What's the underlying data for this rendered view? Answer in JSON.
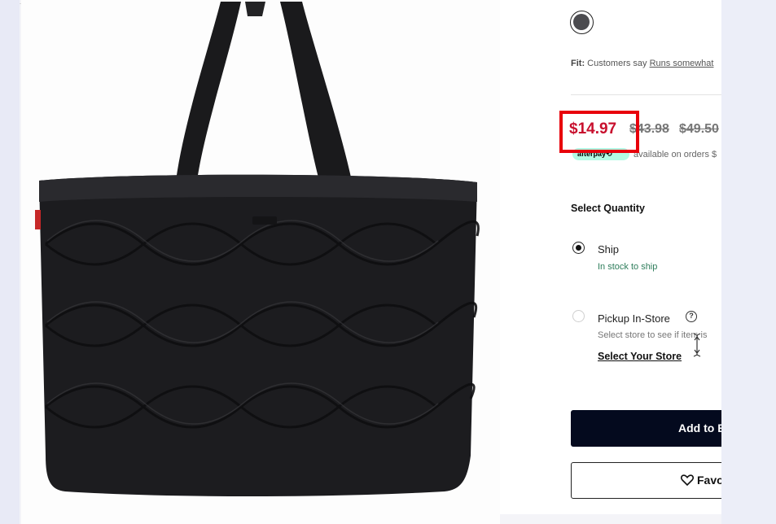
{
  "product": {
    "image_alt": "Black quilted puffer tote bag",
    "color_swatch": "#4b4b4f"
  },
  "fit": {
    "label": "Fit:",
    "text": "Customers say",
    "link": "Runs somewhat"
  },
  "price": {
    "sale": "$14.97",
    "original_1": "$43.98",
    "original_2": "$49.50",
    "sale_color": "#c8102e",
    "highlight_color": "#e8000b"
  },
  "afterpay": {
    "badge": "afterpay⟲",
    "text": "available on orders $"
  },
  "quantity": {
    "heading": "Select Quantity"
  },
  "fulfillment": {
    "ship": {
      "label": "Ship",
      "status": "In stock to ship",
      "selected": true
    },
    "pickup": {
      "label": "Pickup In-Store",
      "help": "?",
      "status": "Select store to see if item is",
      "link": "Select Your Store",
      "selected": false
    }
  },
  "actions": {
    "add_to_bag": "Add to B",
    "favorite": "Favo"
  },
  "colors": {
    "primary_button": "#040a1e",
    "stock_green": "#2e7d5b"
  }
}
